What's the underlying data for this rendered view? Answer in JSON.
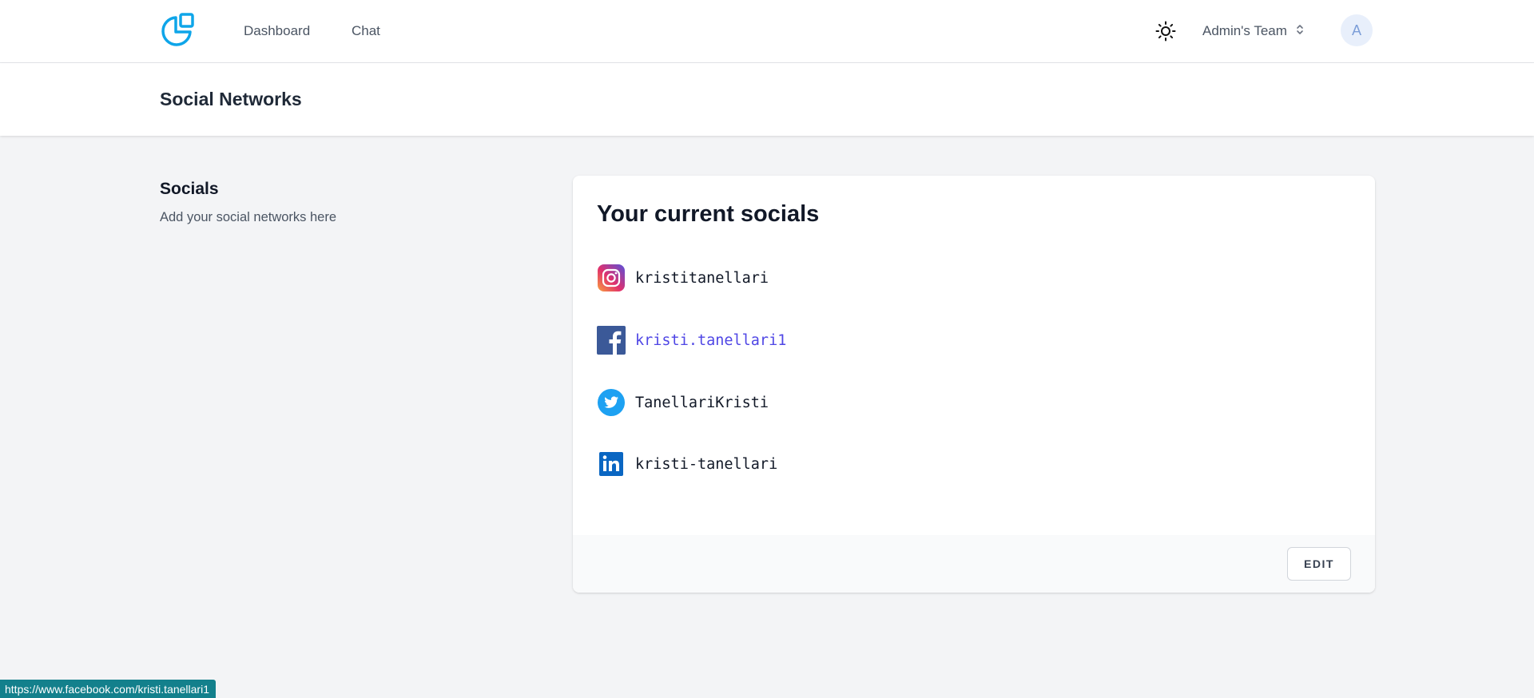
{
  "nav": {
    "links": [
      "Dashboard",
      "Chat"
    ],
    "team": "Admin's Team",
    "avatar_initial": "A",
    "icons": {
      "logo": "pie-chart-logo-icon",
      "theme": "sun-icon",
      "team_switch": "chevron-up-down-icon"
    },
    "logo_color": "#0ea5e9"
  },
  "page": {
    "title": "Social Networks"
  },
  "section": {
    "title": "Socials",
    "description": "Add your social networks here"
  },
  "card": {
    "title": "Your current socials",
    "socials": [
      {
        "network": "instagram",
        "icon": "instagram-icon",
        "handle": "kristitanellari"
      },
      {
        "network": "facebook",
        "icon": "facebook-icon",
        "handle": "kristi.tanellari1",
        "hovered": true
      },
      {
        "network": "twitter",
        "icon": "twitter-icon",
        "handle": "TanellariKristi"
      },
      {
        "network": "linkedin",
        "icon": "linkedin-icon",
        "handle": "kristi-tanellari"
      }
    ],
    "edit_label": "EDIT"
  },
  "status_bar": {
    "url": "https://www.facebook.com/kristi.tanellari1"
  },
  "colors": {
    "accent_link": "#4f46e5",
    "background": "#f3f4f6",
    "status_bar": "#13808c"
  }
}
